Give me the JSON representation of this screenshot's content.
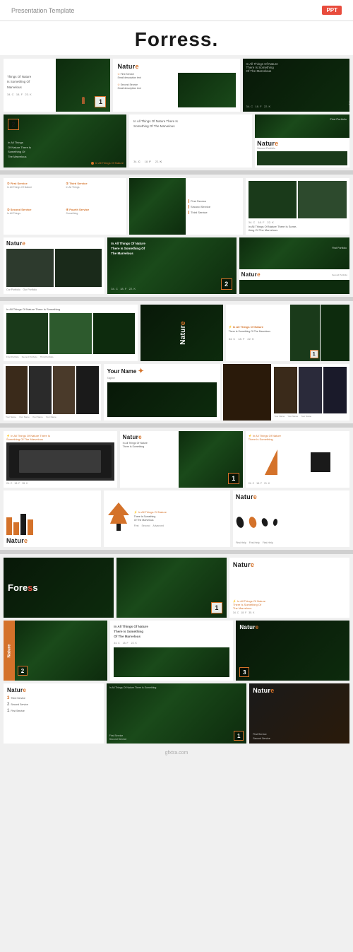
{
  "header": {
    "title": "Presentation Template",
    "badge": "PPT"
  },
  "main_title": "Forress.",
  "accent_color": "#d4722a",
  "red_color": "#e84c3d",
  "slides": {
    "nature_label": "Nature",
    "nature_e_orange": "e",
    "num1": "1",
    "num2": "2",
    "num3": "3",
    "tagline": "In All Things Of Nature There Is Something Of The Marvelous",
    "stat1": "24. C",
    "stat2": "18. F",
    "stat3": "23. K",
    "stat4": "32. K",
    "service1": "First Service",
    "service2": "Second Service",
    "service3": "Third Service",
    "service4": "Fourth Service",
    "portfolio1": "First Portfolio",
    "portfolio2": "Second Portfolio",
    "your_name": "Your Name",
    "forress_title": "Foress",
    "forress_s": "S"
  },
  "watermark": "gfxtra.com"
}
